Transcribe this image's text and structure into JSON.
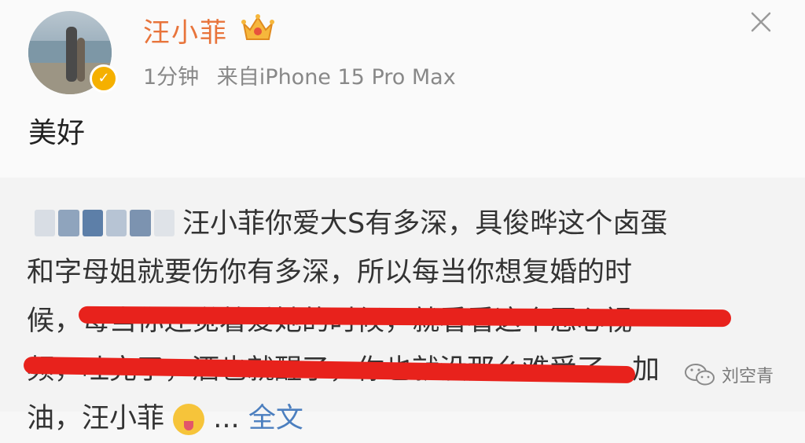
{
  "post": {
    "username": "汪小菲",
    "time": "1分钟",
    "source": "来自iPhone 15 Pro Max",
    "text": "美好"
  },
  "reply": {
    "lines": [
      "汪小菲你爱大S有多深，具俊晔这个卤蛋",
      "和字母姐就要伤你有多深，所以每当你想复婚的时",
      "候，每当你还觉着爱她的时候，就看看这个恶心视",
      "频，吐完了，酒也就醒了，你也就没那么难受了，加",
      "油，汪小菲"
    ],
    "ellipsis": "...",
    "full_text_link": "全文"
  },
  "watermark": {
    "text": "刘空青"
  },
  "colors": {
    "username": "#e8743b",
    "highlight": "#e8221c",
    "link": "#4c7fbf",
    "verify": "#f5b000"
  },
  "icons": {
    "close": "close-icon",
    "crown": "crown-icon",
    "verify": "verified-badge-icon",
    "emoji": "tongue-emoji-icon",
    "watermark": "wechat-icon"
  }
}
